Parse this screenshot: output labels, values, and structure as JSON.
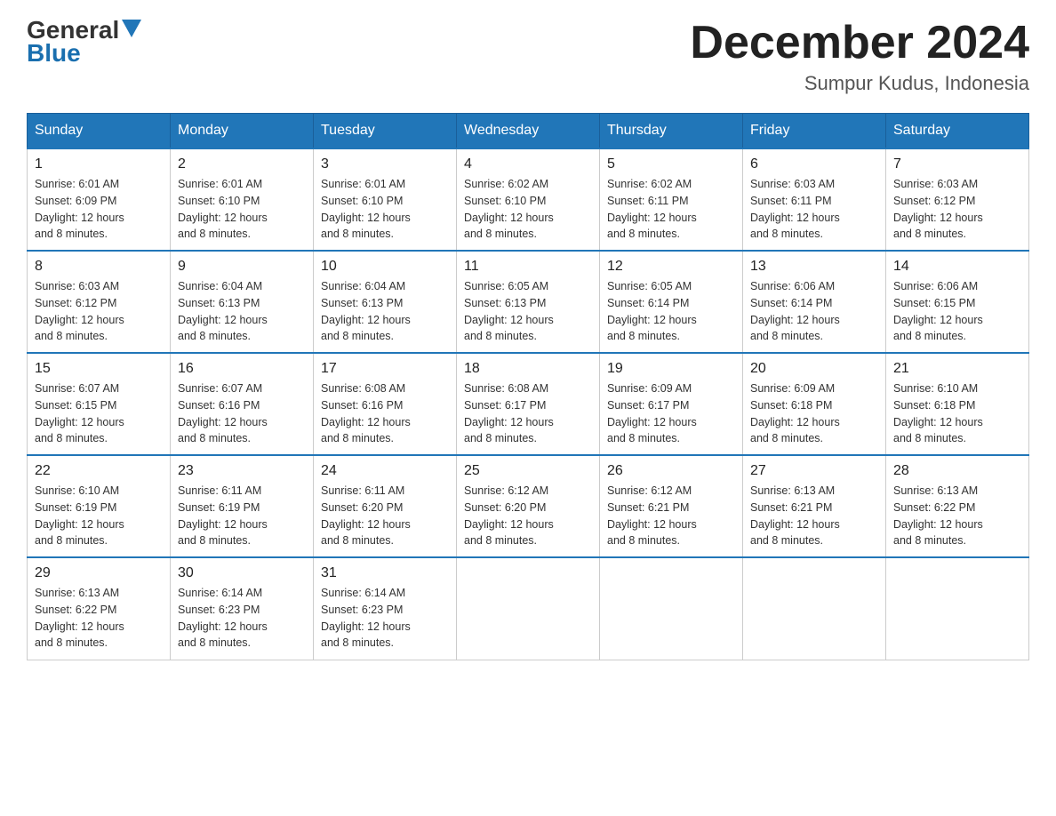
{
  "header": {
    "logo_general": "General",
    "logo_blue": "Blue",
    "month_title": "December 2024",
    "location": "Sumpur Kudus, Indonesia"
  },
  "days_of_week": [
    "Sunday",
    "Monday",
    "Tuesday",
    "Wednesday",
    "Thursday",
    "Friday",
    "Saturday"
  ],
  "weeks": [
    [
      {
        "day": "1",
        "sunrise": "6:01 AM",
        "sunset": "6:09 PM",
        "daylight": "12 hours and 8 minutes."
      },
      {
        "day": "2",
        "sunrise": "6:01 AM",
        "sunset": "6:10 PM",
        "daylight": "12 hours and 8 minutes."
      },
      {
        "day": "3",
        "sunrise": "6:01 AM",
        "sunset": "6:10 PM",
        "daylight": "12 hours and 8 minutes."
      },
      {
        "day": "4",
        "sunrise": "6:02 AM",
        "sunset": "6:10 PM",
        "daylight": "12 hours and 8 minutes."
      },
      {
        "day": "5",
        "sunrise": "6:02 AM",
        "sunset": "6:11 PM",
        "daylight": "12 hours and 8 minutes."
      },
      {
        "day": "6",
        "sunrise": "6:03 AM",
        "sunset": "6:11 PM",
        "daylight": "12 hours and 8 minutes."
      },
      {
        "day": "7",
        "sunrise": "6:03 AM",
        "sunset": "6:12 PM",
        "daylight": "12 hours and 8 minutes."
      }
    ],
    [
      {
        "day": "8",
        "sunrise": "6:03 AM",
        "sunset": "6:12 PM",
        "daylight": "12 hours and 8 minutes."
      },
      {
        "day": "9",
        "sunrise": "6:04 AM",
        "sunset": "6:13 PM",
        "daylight": "12 hours and 8 minutes."
      },
      {
        "day": "10",
        "sunrise": "6:04 AM",
        "sunset": "6:13 PM",
        "daylight": "12 hours and 8 minutes."
      },
      {
        "day": "11",
        "sunrise": "6:05 AM",
        "sunset": "6:13 PM",
        "daylight": "12 hours and 8 minutes."
      },
      {
        "day": "12",
        "sunrise": "6:05 AM",
        "sunset": "6:14 PM",
        "daylight": "12 hours and 8 minutes."
      },
      {
        "day": "13",
        "sunrise": "6:06 AM",
        "sunset": "6:14 PM",
        "daylight": "12 hours and 8 minutes."
      },
      {
        "day": "14",
        "sunrise": "6:06 AM",
        "sunset": "6:15 PM",
        "daylight": "12 hours and 8 minutes."
      }
    ],
    [
      {
        "day": "15",
        "sunrise": "6:07 AM",
        "sunset": "6:15 PM",
        "daylight": "12 hours and 8 minutes."
      },
      {
        "day": "16",
        "sunrise": "6:07 AM",
        "sunset": "6:16 PM",
        "daylight": "12 hours and 8 minutes."
      },
      {
        "day": "17",
        "sunrise": "6:08 AM",
        "sunset": "6:16 PM",
        "daylight": "12 hours and 8 minutes."
      },
      {
        "day": "18",
        "sunrise": "6:08 AM",
        "sunset": "6:17 PM",
        "daylight": "12 hours and 8 minutes."
      },
      {
        "day": "19",
        "sunrise": "6:09 AM",
        "sunset": "6:17 PM",
        "daylight": "12 hours and 8 minutes."
      },
      {
        "day": "20",
        "sunrise": "6:09 AM",
        "sunset": "6:18 PM",
        "daylight": "12 hours and 8 minutes."
      },
      {
        "day": "21",
        "sunrise": "6:10 AM",
        "sunset": "6:18 PM",
        "daylight": "12 hours and 8 minutes."
      }
    ],
    [
      {
        "day": "22",
        "sunrise": "6:10 AM",
        "sunset": "6:19 PM",
        "daylight": "12 hours and 8 minutes."
      },
      {
        "day": "23",
        "sunrise": "6:11 AM",
        "sunset": "6:19 PM",
        "daylight": "12 hours and 8 minutes."
      },
      {
        "day": "24",
        "sunrise": "6:11 AM",
        "sunset": "6:20 PM",
        "daylight": "12 hours and 8 minutes."
      },
      {
        "day": "25",
        "sunrise": "6:12 AM",
        "sunset": "6:20 PM",
        "daylight": "12 hours and 8 minutes."
      },
      {
        "day": "26",
        "sunrise": "6:12 AM",
        "sunset": "6:21 PM",
        "daylight": "12 hours and 8 minutes."
      },
      {
        "day": "27",
        "sunrise": "6:13 AM",
        "sunset": "6:21 PM",
        "daylight": "12 hours and 8 minutes."
      },
      {
        "day": "28",
        "sunrise": "6:13 AM",
        "sunset": "6:22 PM",
        "daylight": "12 hours and 8 minutes."
      }
    ],
    [
      {
        "day": "29",
        "sunrise": "6:13 AM",
        "sunset": "6:22 PM",
        "daylight": "12 hours and 8 minutes."
      },
      {
        "day": "30",
        "sunrise": "6:14 AM",
        "sunset": "6:23 PM",
        "daylight": "12 hours and 8 minutes."
      },
      {
        "day": "31",
        "sunrise": "6:14 AM",
        "sunset": "6:23 PM",
        "daylight": "12 hours and 8 minutes."
      },
      null,
      null,
      null,
      null
    ]
  ],
  "labels": {
    "sunrise": "Sunrise: ",
    "sunset": "Sunset: ",
    "daylight": "Daylight: 12 hours"
  }
}
